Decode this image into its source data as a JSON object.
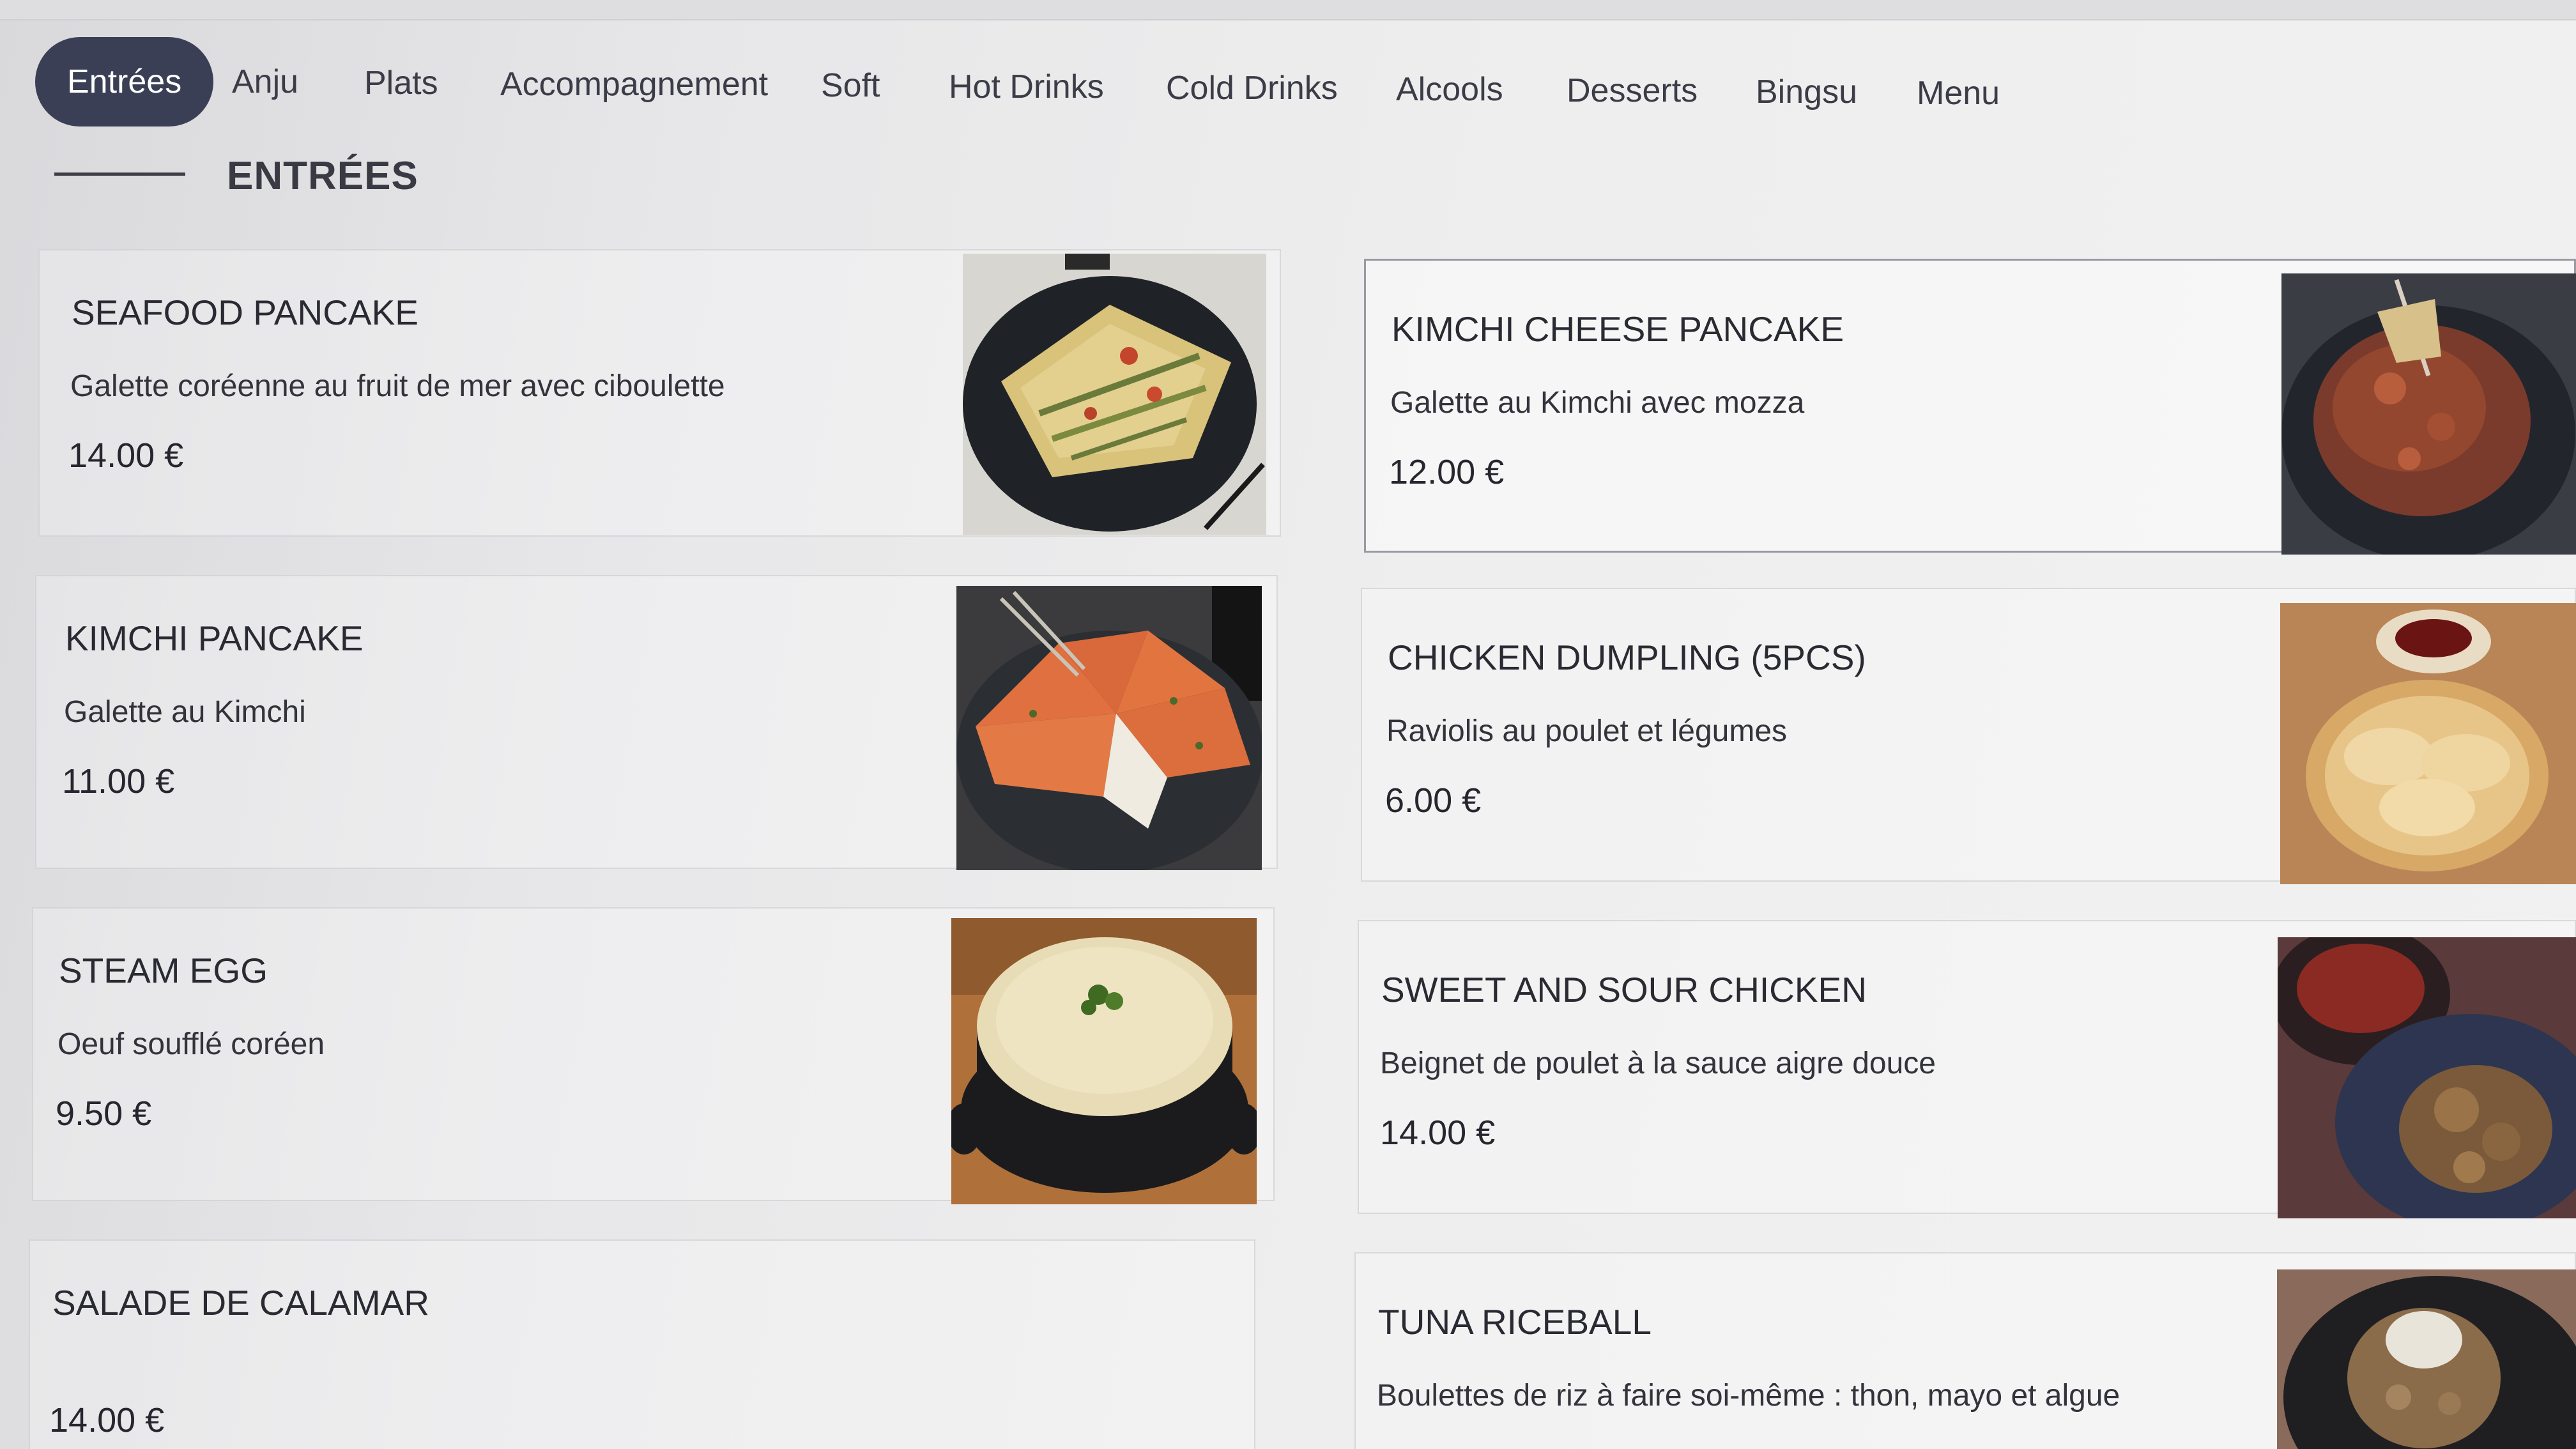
{
  "nav": {
    "tabs": [
      {
        "label": "Entrées",
        "active": true
      },
      {
        "label": "Anju",
        "active": false
      },
      {
        "label": "Plats",
        "active": false
      },
      {
        "label": "Accompagnement",
        "active": false
      },
      {
        "label": "Soft",
        "active": false
      },
      {
        "label": "Hot Drinks",
        "active": false
      },
      {
        "label": "Cold Drinks",
        "active": false
      },
      {
        "label": "Alcools",
        "active": false
      },
      {
        "label": "Desserts",
        "active": false
      },
      {
        "label": "Bingsu",
        "active": false
      },
      {
        "label": "Menu",
        "active": false
      }
    ]
  },
  "section": {
    "title": "ENTRÉES"
  },
  "items": [
    {
      "name": "SEAFOOD PANCAKE",
      "description": "Galette coréenne au fruit de mer avec ciboulette",
      "price": "14.00 €",
      "photo": "seafood-pancake-photo"
    },
    {
      "name": "KIMCHI CHEESE PANCAKE",
      "description": "Galette au Kimchi avec mozza",
      "price": "12.00 €",
      "photo": "kimchi-cheese-pancake-photo"
    },
    {
      "name": "KIMCHI PANCAKE",
      "description": "Galette au Kimchi",
      "price": "11.00 €",
      "photo": "kimchi-pancake-photo"
    },
    {
      "name": "CHICKEN DUMPLING (5PCS)",
      "description": "Raviolis au poulet et légumes",
      "price": "6.00 €",
      "photo": "chicken-dumpling-photo"
    },
    {
      "name": "STEAM EGG",
      "description": "Oeuf soufflé coréen",
      "price": "9.50 €",
      "photo": "steam-egg-photo"
    },
    {
      "name": "SWEET AND SOUR CHICKEN",
      "description": "Beignet de poulet à la sauce aigre douce",
      "price": "14.00 €",
      "photo": "sweet-sour-chicken-photo"
    },
    {
      "name": "SALADE DE CALAMAR",
      "description": "",
      "price": "14.00 €",
      "photo": ""
    },
    {
      "name": "TUNA RICEBALL",
      "description": "Boulettes de riz à faire soi-même : thon, mayo et algue",
      "price": "",
      "photo": "tuna-riceball-photo"
    }
  ],
  "colors": {
    "active_tab_bg": "#3a3f55",
    "active_tab_text": "#ffffff",
    "text": "#2d2d33"
  }
}
